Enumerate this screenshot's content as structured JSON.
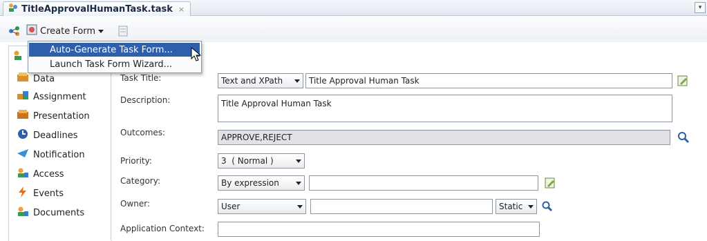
{
  "tab": {
    "title": "TitleApprovalHumanTask.task",
    "close": "×"
  },
  "toolbar": {
    "create_form_label": "Create Form"
  },
  "menu": {
    "items": [
      {
        "label": "Auto-Generate Task Form..."
      },
      {
        "label": "Launch Task Form Wizard..."
      }
    ]
  },
  "nav": {
    "items": [
      {
        "label": "Data",
        "icon": "data-icon"
      },
      {
        "label": "Assignment",
        "icon": "assignment-icon"
      },
      {
        "label": "Presentation",
        "icon": "presentation-icon"
      },
      {
        "label": "Deadlines",
        "icon": "deadlines-icon"
      },
      {
        "label": "Notification",
        "icon": "notification-icon"
      },
      {
        "label": "Access",
        "icon": "access-icon"
      },
      {
        "label": "Events",
        "icon": "events-icon"
      },
      {
        "label": "Documents",
        "icon": "documents-icon"
      }
    ]
  },
  "form": {
    "task_title": {
      "label": "Task Title:",
      "mode": "Text and XPath",
      "value": "Title Approval Human Task"
    },
    "description": {
      "label": "Description:",
      "value": "Title Approval Human Task"
    },
    "outcomes": {
      "label": "Outcomes:",
      "value": "APPROVE,REJECT"
    },
    "priority": {
      "label": "Priority:",
      "value": "3  ( Normal )"
    },
    "category": {
      "label": "Category:",
      "mode": "By expression",
      "value": ""
    },
    "owner": {
      "label": "Owner:",
      "type": "User",
      "value": "",
      "static": "Static"
    },
    "app_context": {
      "label": "Application Context:",
      "value": ""
    }
  },
  "colors": {
    "menu_highlight": "#2e5fae",
    "outcomes_bg": "#e0e2e6"
  }
}
